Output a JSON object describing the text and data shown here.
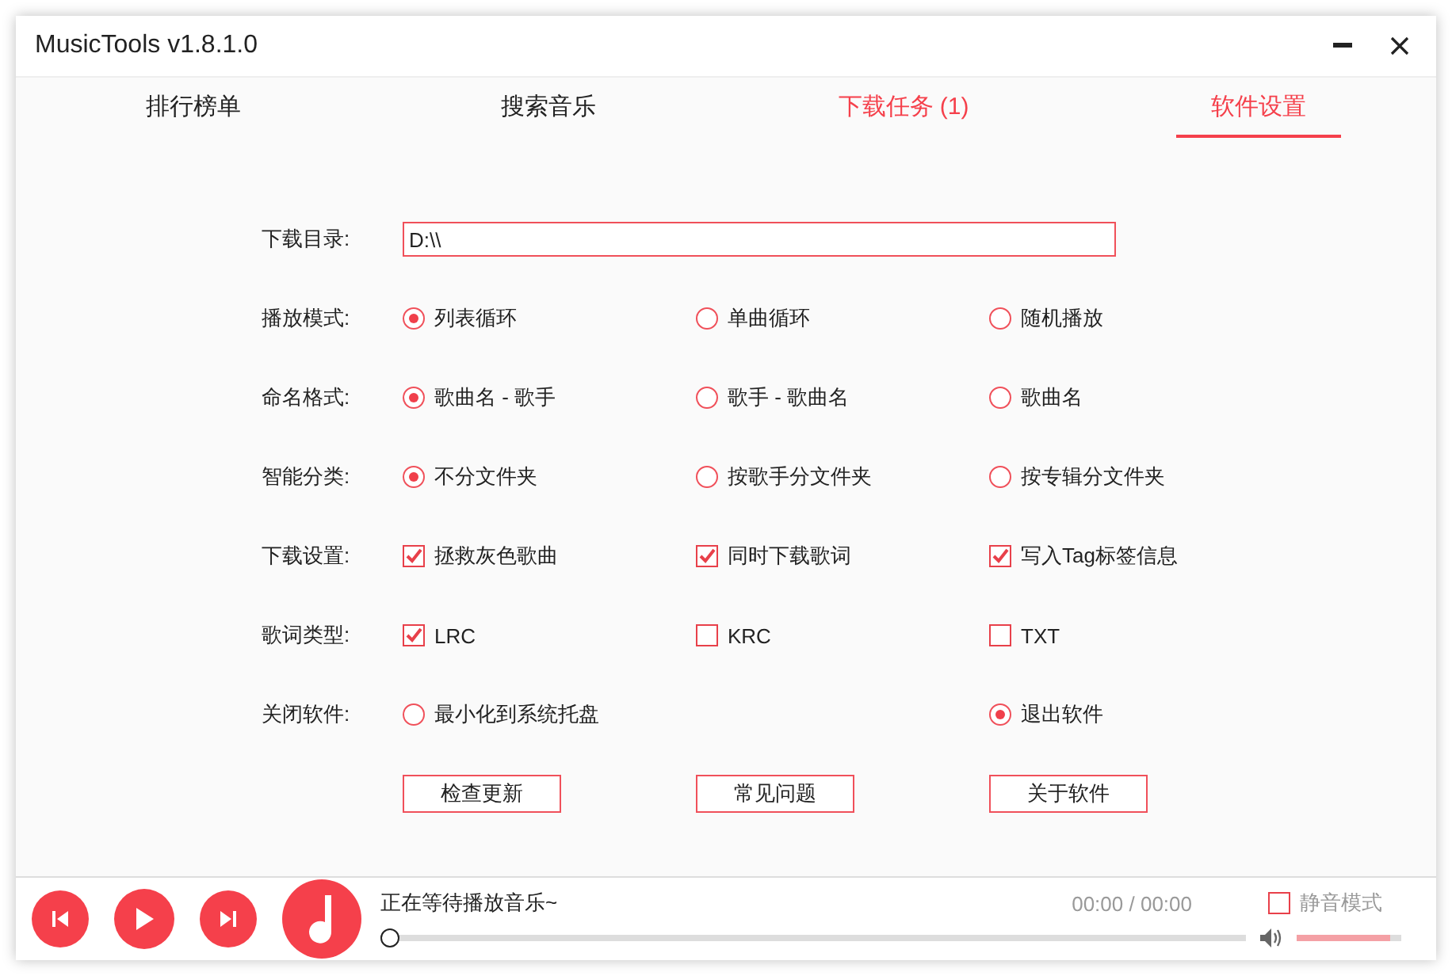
{
  "window": {
    "title": "MusicTools v1.8.1.0"
  },
  "tabs": [
    {
      "label": "排行榜单",
      "selected": false,
      "alert": false
    },
    {
      "label": "搜索音乐",
      "selected": false,
      "alert": false
    },
    {
      "label": "下载任务 (1)",
      "selected": false,
      "alert": true
    },
    {
      "label": "软件设置",
      "selected": true,
      "alert": false
    }
  ],
  "download_dir": {
    "label": "下载目录:",
    "value": "D:\\\\"
  },
  "rows": [
    {
      "label": "播放模式:",
      "kind": "radio",
      "options": [
        {
          "label": "列表循环",
          "selected": true
        },
        {
          "label": "单曲循环",
          "selected": false
        },
        {
          "label": "随机播放",
          "selected": false
        }
      ]
    },
    {
      "label": "命名格式:",
      "kind": "radio",
      "options": [
        {
          "label": "歌曲名 - 歌手",
          "selected": true
        },
        {
          "label": "歌手 - 歌曲名",
          "selected": false
        },
        {
          "label": "歌曲名",
          "selected": false
        }
      ]
    },
    {
      "label": "智能分类:",
      "kind": "radio",
      "options": [
        {
          "label": "不分文件夹",
          "selected": true
        },
        {
          "label": "按歌手分文件夹",
          "selected": false
        },
        {
          "label": "按专辑分文件夹",
          "selected": false
        }
      ]
    },
    {
      "label": "下载设置:",
      "kind": "checkbox",
      "options": [
        {
          "label": "拯救灰色歌曲",
          "checked": true
        },
        {
          "label": "同时下载歌词",
          "checked": true
        },
        {
          "label": "写入Tag标签信息",
          "checked": true
        }
      ]
    },
    {
      "label": "歌词类型:",
      "kind": "checkbox",
      "options": [
        {
          "label": "LRC",
          "checked": true
        },
        {
          "label": "KRC",
          "checked": false
        },
        {
          "label": "TXT",
          "checked": false
        }
      ]
    },
    {
      "label": "关闭软件:",
      "kind": "radio_split",
      "options": [
        {
          "label": "最小化到系统托盘",
          "selected": false
        },
        {
          "label": "退出软件",
          "selected": true
        }
      ]
    }
  ],
  "buttons": [
    "检查更新",
    "常见问题",
    "关于软件"
  ],
  "player": {
    "status": "正在等待播放音乐~",
    "time": "00:00 / 00:00",
    "progress": {
      "level": 0
    },
    "mute": {
      "label": "静音模式",
      "checked": false
    },
    "volume": {
      "level": 0.9
    }
  }
}
